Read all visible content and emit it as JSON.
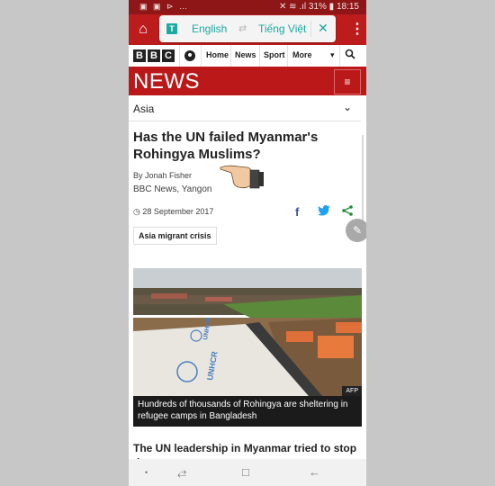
{
  "status_bar": {
    "left_icons": "▣ ▣ ⊳ …",
    "right": "✕ ≋ .ıl 31% ▮ 18:15"
  },
  "translate_bar": {
    "source_language": "English",
    "target_language": "Tiếng Việt",
    "badge": "T",
    "swap_glyph": "⇄",
    "close_glyph": "✕"
  },
  "toolbar": {
    "home_glyph": "⌂",
    "menu_glyph": "⋮"
  },
  "bbc_nav": {
    "logo": [
      "B",
      "B",
      "C"
    ],
    "links": [
      "Home",
      "News",
      "Sport",
      "More"
    ],
    "more_arrow": "▾",
    "search_glyph": "⚲"
  },
  "news_header": {
    "title": "NEWS",
    "menu_glyph": "≡"
  },
  "section": {
    "label": "Asia",
    "chevron": "⌄"
  },
  "article": {
    "headline": "Has the UN failed Myanmar's Rohingya Muslims?",
    "byline": "By Jonah Fisher",
    "location": "BBC News, Yangon",
    "date_icon": "◷",
    "date": "28 September 2017",
    "share_icons": {
      "facebook": "f",
      "twitter": "t",
      "share": "<"
    },
    "tag": "Asia migrant crisis",
    "image_credit": "AFP",
    "image_caption": "Hundreds of thousands of Rohingya are sheltering in refugee camps in Bangladesh",
    "lead": "The UN leadership in Myanmar tried to stop the"
  },
  "fab": {
    "glyph": "✎"
  },
  "android_nav": {
    "dot": "•",
    "recent": "⥄",
    "home": "□",
    "back": "←"
  },
  "colors": {
    "bbc_red": "#bb1919",
    "status_red": "#8e1616",
    "translate_teal": "#1ba9a0",
    "facebook_blue": "#3b5998",
    "twitter_blue": "#1da1f2",
    "share_green": "#1e8b3a"
  }
}
